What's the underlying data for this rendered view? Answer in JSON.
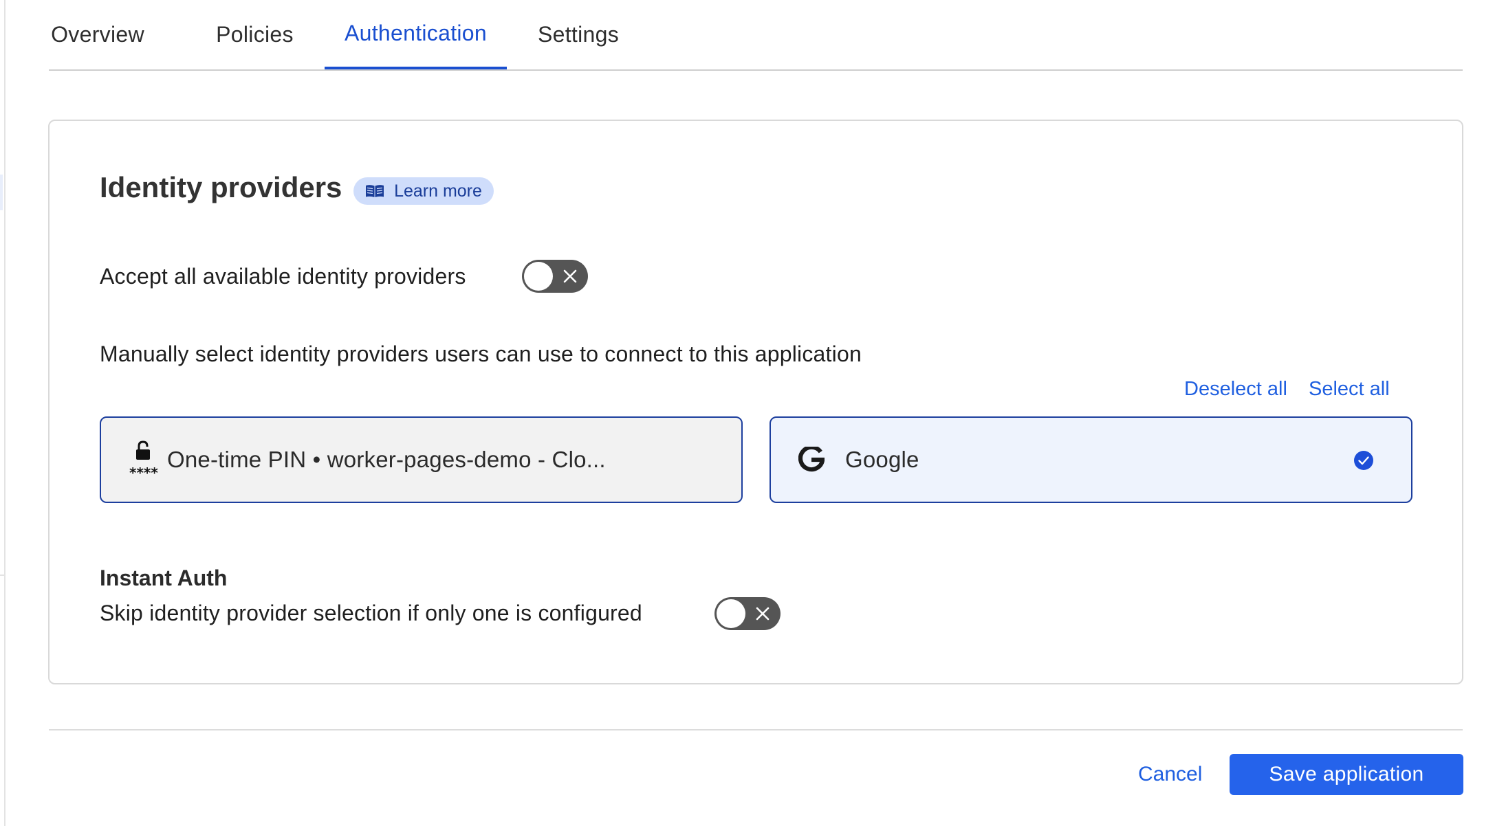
{
  "tabs": [
    {
      "label": "Overview",
      "active": false
    },
    {
      "label": "Policies",
      "active": false
    },
    {
      "label": "Authentication",
      "active": true
    },
    {
      "label": "Settings",
      "active": false
    }
  ],
  "identity": {
    "heading": "Identity providers",
    "learn_more": "Learn more",
    "learn_more_icon": "book-icon",
    "accept_all_label": "Accept all available identity providers",
    "accept_all_enabled": false,
    "manual_label": "Manually select identity providers users can use to connect to this application",
    "deselect_all": "Deselect all",
    "select_all": "Select all",
    "providers": [
      {
        "name": "One-time PIN • worker-pages-demo - Clo...",
        "icon": "lock-pin-icon",
        "selected": false
      },
      {
        "name": "Google",
        "icon": "google-icon",
        "selected": true
      }
    ]
  },
  "instant_auth": {
    "heading": "Instant Auth",
    "label": "Skip identity provider selection if only one is configured",
    "enabled": false
  },
  "footer": {
    "cancel": "Cancel",
    "save": "Save application"
  },
  "colors": {
    "accent": "#1a4fd0",
    "link": "#1f5fe0",
    "primary_button": "#2563eb",
    "toggle_off": "#555555",
    "selected_card_bg": "#eef3fd"
  }
}
